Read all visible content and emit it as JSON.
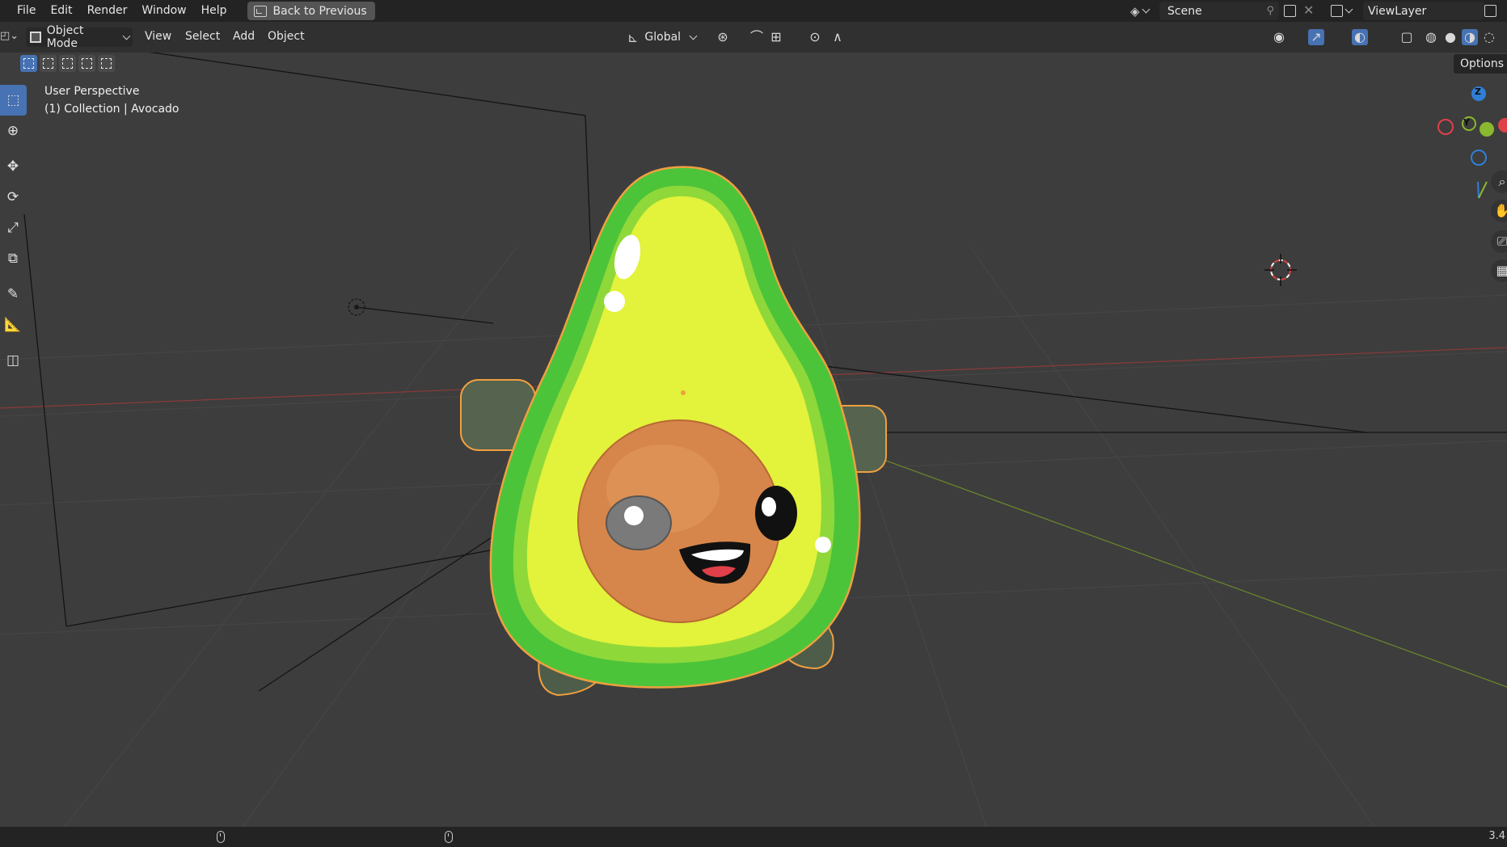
{
  "menubar": {
    "items": [
      "File",
      "Edit",
      "Render",
      "Window",
      "Help"
    ],
    "back_button": "Back to Previous",
    "scene_name": "Scene",
    "view_layer": "ViewLayer"
  },
  "header": {
    "mode": "Object Mode",
    "menus": [
      "View",
      "Select",
      "Add",
      "Object"
    ],
    "transform_orientation": "Global",
    "options_label": "Options"
  },
  "viewport": {
    "perspective": "User Perspective",
    "collection_info": "(1) Collection | Avocado"
  },
  "gizmo": {
    "z_label": "Z",
    "y_label": "Y",
    "x_color": "#e0404a",
    "y_color": "#8ab82e",
    "z_color": "#2f7fd8"
  },
  "statusbar": {
    "version": "3.4"
  },
  "icons": {
    "select": "select-box-icon",
    "cursor": "cursor-icon",
    "move": "move-icon",
    "rotate": "rotate-icon",
    "scale": "scale-icon",
    "transform": "transform-icon",
    "annotate": "annotate-icon",
    "measure": "measure-icon",
    "add_cube": "add-cube-icon"
  },
  "colors": {
    "accent": "#4772b3",
    "avocado_skin": "#4cc43a",
    "avocado_flesh": "#e3f23a",
    "avocado_pit": "#d6864a",
    "selection_outline": "#f0a040"
  }
}
